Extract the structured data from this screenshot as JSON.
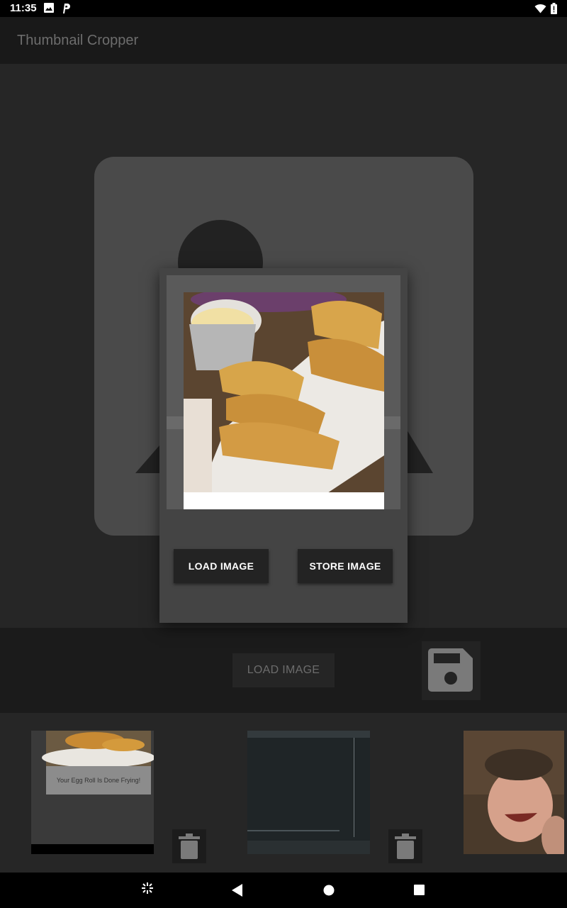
{
  "status_bar": {
    "time": "11:35",
    "icons": [
      "image-icon",
      "p-app-icon",
      "wifi-icon",
      "battery-icon"
    ]
  },
  "app_bar": {
    "title": "Thumbnail Cropper"
  },
  "main": {
    "placeholder_icon": "image-placeholder-icon",
    "load_image_label": "LOAD IMAGE",
    "save_icon": "floppy-disk-icon"
  },
  "dialog": {
    "load_label": "LOAD IMAGE",
    "store_label": "STORE IMAGE",
    "preview_icon": "egg-roll-photo"
  },
  "thumbnails": [
    {
      "caption": "Your Egg Roll Is Done Frying!",
      "icon": "egg-roll-screenshot-thumbnail"
    },
    {
      "icon": "terminal-screenshot-thumbnail"
    },
    {
      "icon": "laughing-man-thumbnail"
    }
  ],
  "navigation_bar": {
    "icons": [
      "apps-icon",
      "back-icon",
      "home-icon",
      "recents-icon"
    ]
  },
  "colors": {
    "background": "#262626",
    "app_bar": "#191919",
    "dialog": "#444444",
    "button": "#232323"
  }
}
